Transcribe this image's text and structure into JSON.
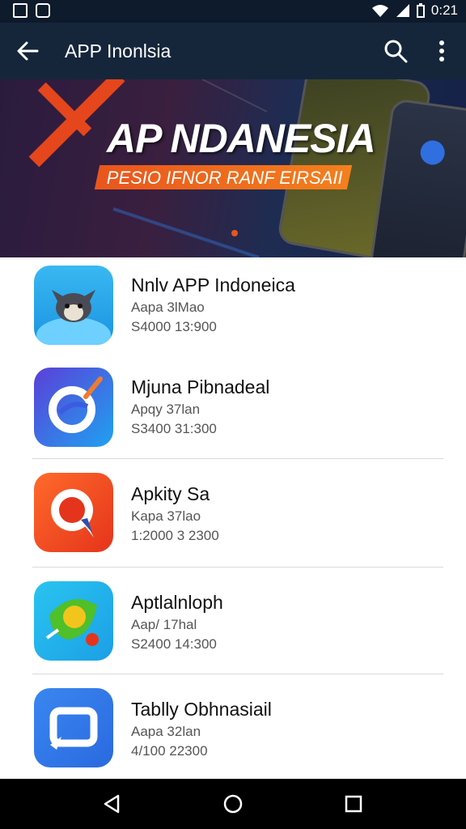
{
  "status_bar": {
    "time": "0:21",
    "icons": [
      "gallery-notification-icon",
      "app-notification-icon",
      "wifi-icon",
      "signal-icon",
      "battery-icon"
    ]
  },
  "app_bar": {
    "title": "APP Inonlsia",
    "icons": [
      "back-arrow-icon",
      "search-icon",
      "more-vert-icon"
    ]
  },
  "banner": {
    "headline": "AP NDANESIA",
    "ribbon": "PESIO IFNOR RANF EIRSAII"
  },
  "apps": [
    {
      "name": "Nnlv APP Indoneica",
      "line1": "Aapa 3lMao",
      "line2": "S4000 13:900",
      "icon": "cat-mascot-icon"
    },
    {
      "name": "Mjuna Pibnadeal",
      "line1": "Apqy 37lan",
      "line2": "S3400 31:300",
      "icon": "swirl-pen-icon"
    },
    {
      "name": "Apkity Sa",
      "line1": "Kapa 37lao",
      "line2": "1:2000 3 2300",
      "icon": "chat-bubble-icon"
    },
    {
      "name": "Aptlalnloph",
      "line1": "Aap/ 17hal",
      "line2": "S2400 14:300",
      "icon": "leaf-globe-icon"
    },
    {
      "name": "Tablly Obhnasiail",
      "line1": "Aapa 32lan",
      "line2": "4/100 22300",
      "icon": "chat-square-icon"
    }
  ],
  "nav_bar": {
    "icons": [
      "back-triangle-icon",
      "home-circle-icon",
      "recents-square-icon"
    ]
  },
  "colors": {
    "status_bar": "#0e1b2c",
    "app_bar": "#15263b",
    "accent_orange": "#e9561d",
    "nav_bar": "#000000"
  }
}
